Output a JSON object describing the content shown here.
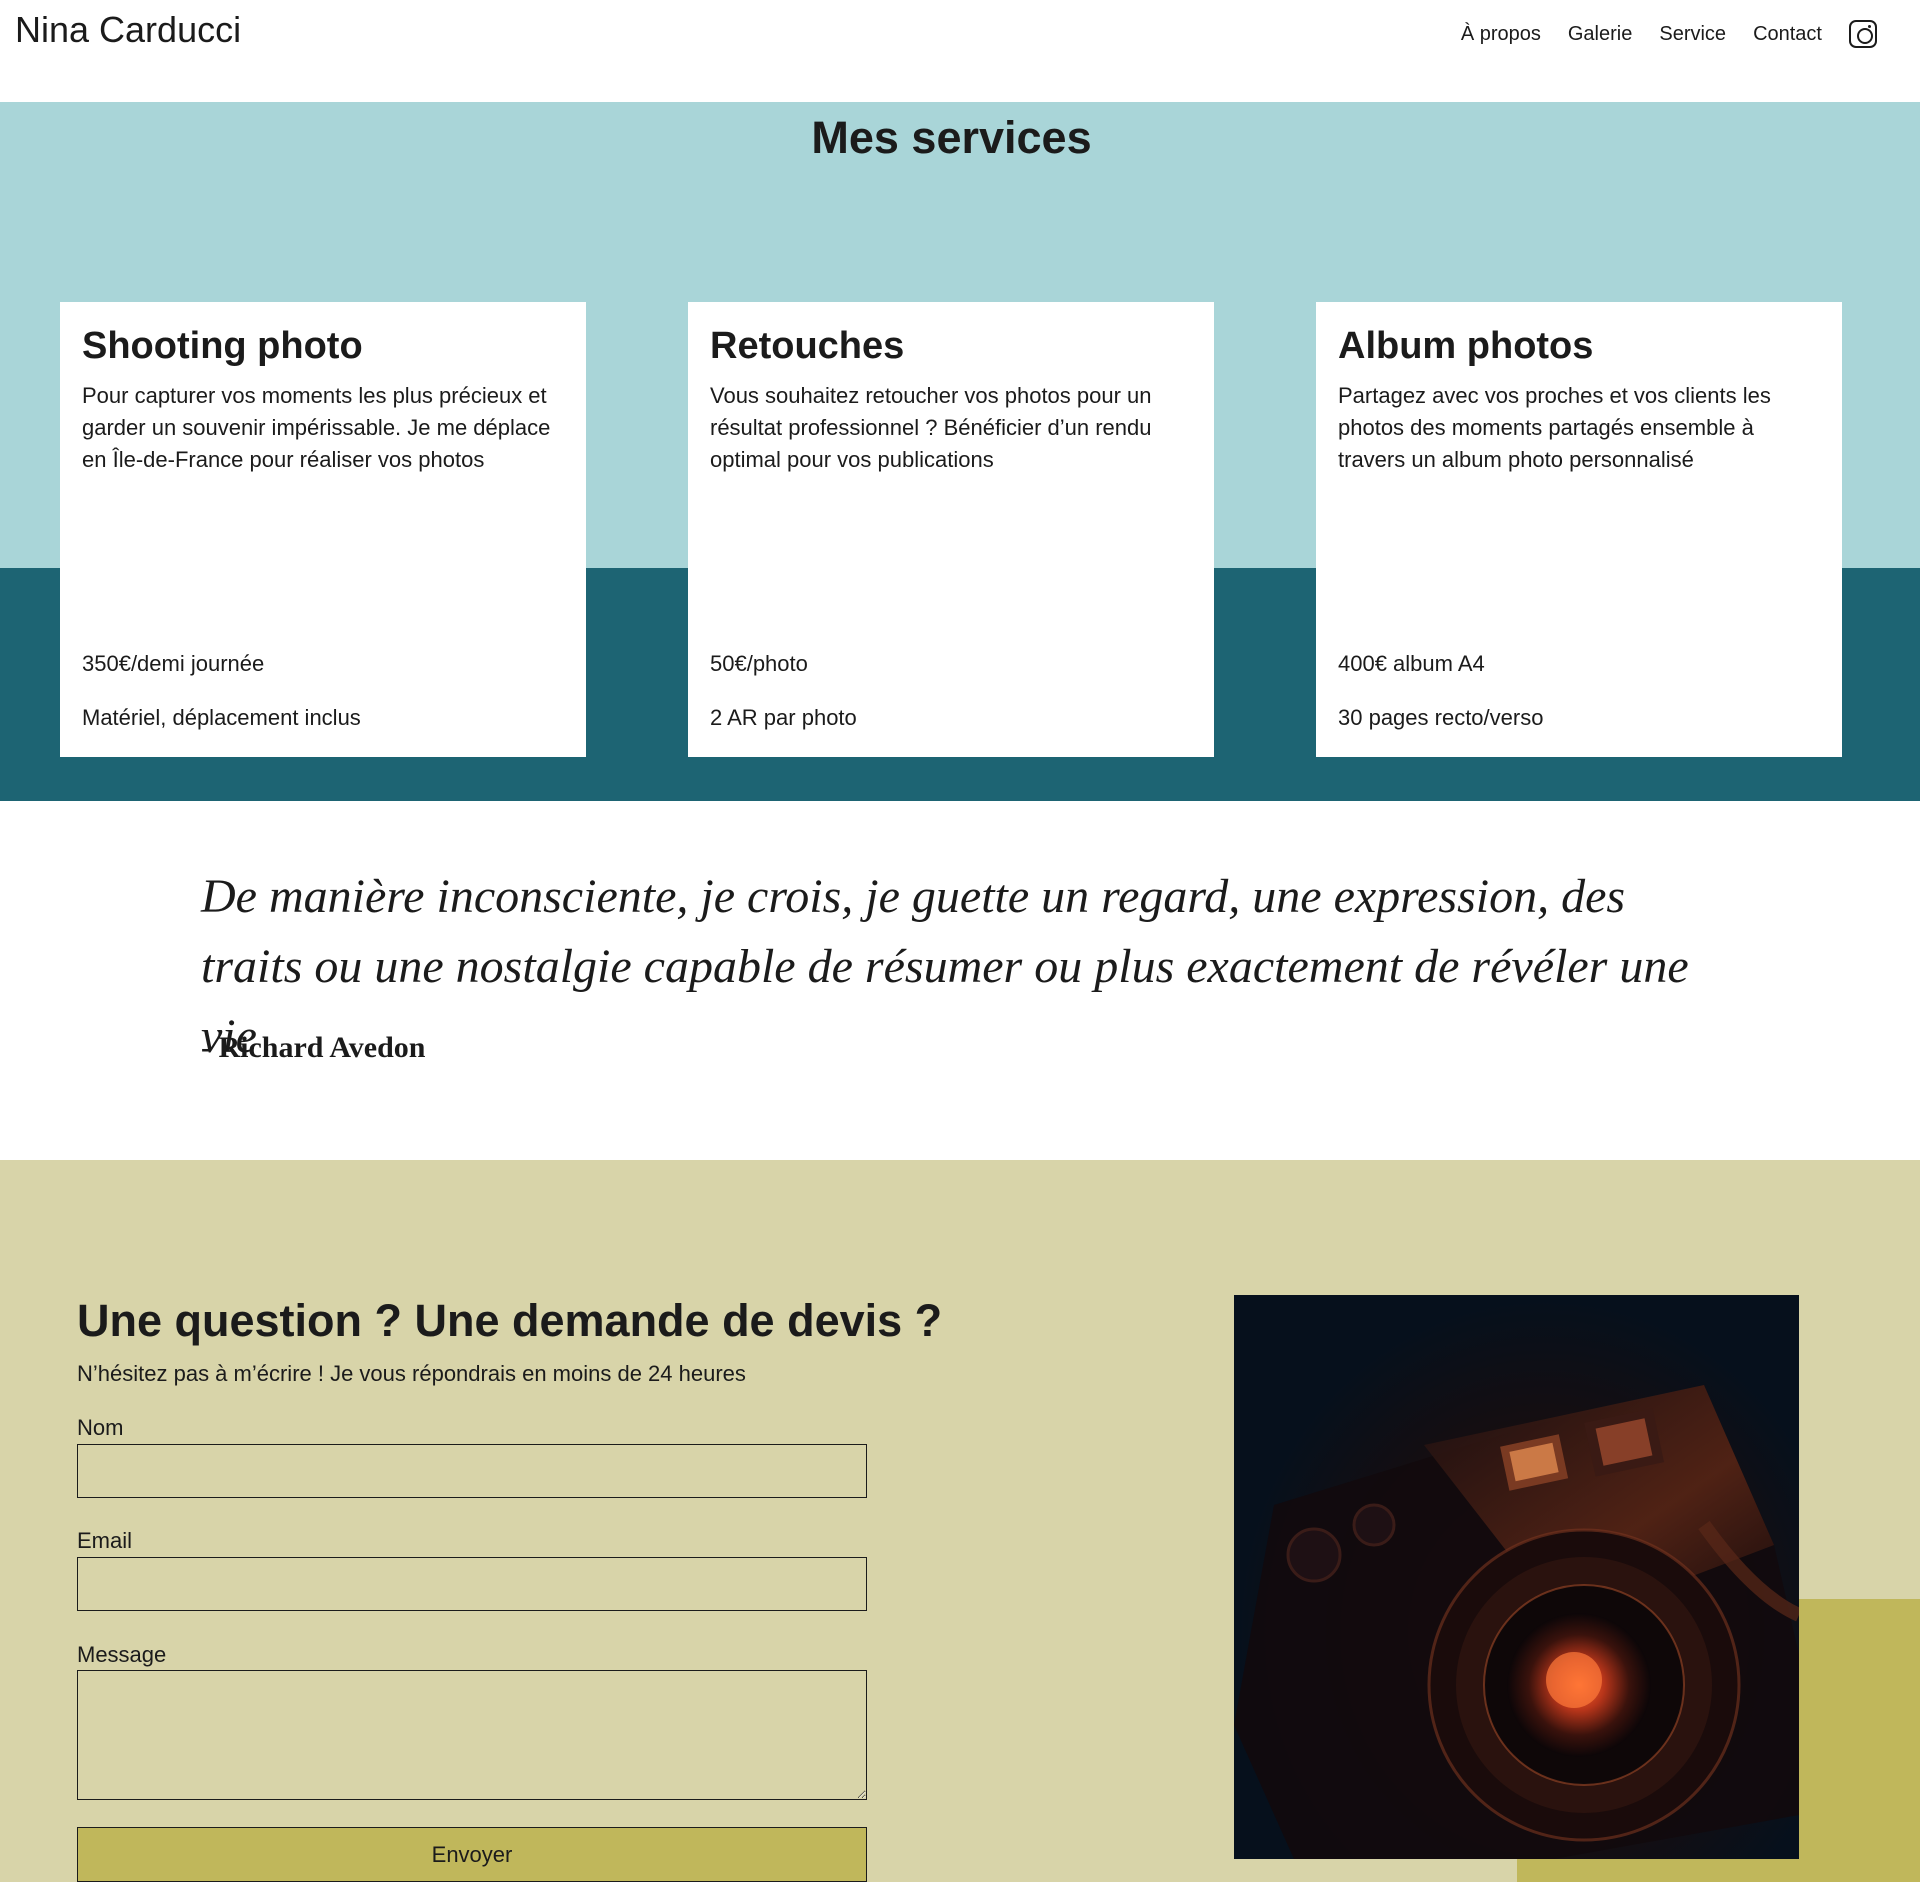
{
  "header": {
    "brand": "Nina Carducci",
    "nav": [
      "À propos",
      "Galerie",
      "Service",
      "Contact"
    ],
    "social_icon": "instagram-icon"
  },
  "services": {
    "title": "Mes services",
    "colors": {
      "top": "#a9d5d8",
      "bottom": "#1d6473"
    },
    "cards": [
      {
        "title": "Shooting photo",
        "description": "Pour capturer vos moments les plus précieux et garder un souvenir impérissable. Je me déplace en Île-de-France pour réaliser vos photos",
        "price": "350€/demi journée",
        "detail": "Matériel, déplacement inclus"
      },
      {
        "title": "Retouches",
        "description": "Vous souhaitez retoucher vos photos pour un résultat professionnel ? Bénéficier d’un rendu optimal pour vos publications",
        "price": "50€/photo",
        "detail": "2 AR par photo"
      },
      {
        "title": "Album photos",
        "description": "Partagez avec vos proches et vos clients les photos des moments partagés ensemble à travers un album photo personnalisé",
        "price": "400€ album A4",
        "detail": "30 pages recto/verso"
      }
    ]
  },
  "quote": {
    "text": "De manière inconsciente, je crois, je guette un regard, une expression, des traits ou une nostalgie capable de résumer ou plus exactement de révéler une vie",
    "author": "- Richard Avedon"
  },
  "contact": {
    "title": "Une question ? Une demande de devis ?",
    "subtitle": "N’hésitez pas à m’écrire ! Je vous répondrais en moins de 24 heures",
    "fields": {
      "name_label": "Nom",
      "name_value": "",
      "email_label": "Email",
      "email_value": "",
      "message_label": "Message",
      "message_value": ""
    },
    "submit_label": "Envoyer",
    "colors": {
      "background": "#d8d4a9",
      "accent": "#c0b75b"
    },
    "image": "camera-photo"
  }
}
